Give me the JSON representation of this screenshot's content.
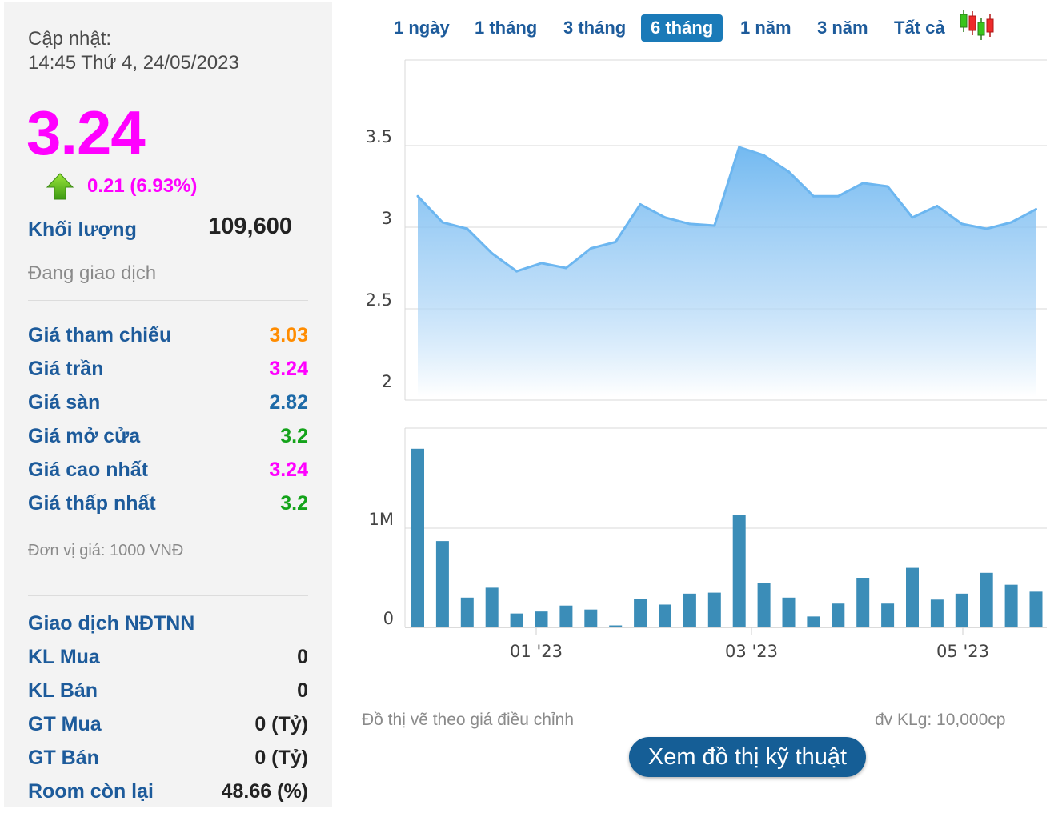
{
  "info": {
    "update_label": "Cập nhật:",
    "update_time": "14:45 Thứ 4, 24/05/2023",
    "price": "3.24",
    "change": "0.21 (6.93%)",
    "volume_label": "Khối lượng",
    "volume_value": "109,600",
    "status": "Đang giao dịch",
    "unit_note": "Đơn vị giá: 1000 VNĐ"
  },
  "price_rows": [
    {
      "label": "Giá tham chiếu",
      "value": "3.03",
      "color": "#ff8c00"
    },
    {
      "label": "Giá trần",
      "value": "3.24",
      "color": "#ff00ff"
    },
    {
      "label": "Giá sàn",
      "value": "2.82",
      "color": "#1d6aa8"
    },
    {
      "label": "Giá mở cửa",
      "value": "3.2",
      "color": "#14a31a"
    },
    {
      "label": "Giá cao nhất",
      "value": "3.24",
      "color": "#ff00ff"
    },
    {
      "label": "Giá thấp nhất",
      "value": "3.2",
      "color": "#14a31a"
    }
  ],
  "foreign": {
    "title": "Giao dịch NĐTNN",
    "rows": [
      {
        "label": "KL Mua",
        "value": "0"
      },
      {
        "label": "KL Bán",
        "value": "0"
      },
      {
        "label": "GT Mua",
        "value": "0 (Tỷ)"
      },
      {
        "label": "GT Bán",
        "value": "0 (Tỷ)"
      },
      {
        "label": "Room còn lại",
        "value": "48.66 (%)"
      }
    ]
  },
  "tabs": [
    {
      "label": "1 ngày",
      "active": false
    },
    {
      "label": "1 tháng",
      "active": false
    },
    {
      "label": "3 tháng",
      "active": false
    },
    {
      "label": "6 tháng",
      "active": true
    },
    {
      "label": "1 năm",
      "active": false
    },
    {
      "label": "3 năm",
      "active": false
    },
    {
      "label": "Tất cả",
      "active": false
    }
  ],
  "icons": {
    "candlestick": "candlestick-chart-icon",
    "up_arrow": "up-arrow-icon"
  },
  "footer": {
    "note": "Đồ thị vẽ theo giá điều chỉnh",
    "volume_unit": "đv KLg: 10,000cp",
    "tech_button": "Xem đồ thị kỹ thuật"
  },
  "chart_data": [
    {
      "type": "area",
      "ylim": [
        2,
        3.5
      ],
      "y_ticks": [
        "3.5",
        "3",
        "2.5",
        "2"
      ],
      "color": "#6cb6f0",
      "values": [
        3.19,
        3.03,
        2.99,
        2.84,
        2.73,
        2.78,
        2.75,
        2.87,
        2.91,
        3.14,
        3.06,
        3.02,
        3.01,
        3.49,
        3.44,
        3.34,
        3.19,
        3.19,
        3.27,
        3.25,
        3.06,
        3.13,
        3.02,
        2.99,
        3.03,
        3.11
      ]
    },
    {
      "type": "bar",
      "y_ticks": [
        "1M",
        "0"
      ],
      "x_ticks": [
        "01 '23",
        "03 '23",
        "05 '23"
      ],
      "color": "#3b8db8",
      "values": [
        1.8,
        0.87,
        0.3,
        0.4,
        0.14,
        0.16,
        0.22,
        0.18,
        0.02,
        0.29,
        0.23,
        0.34,
        0.35,
        1.13,
        0.45,
        0.3,
        0.11,
        0.24,
        0.5,
        0.24,
        0.6,
        0.28,
        0.34,
        0.55,
        0.43,
        0.36
      ]
    }
  ]
}
